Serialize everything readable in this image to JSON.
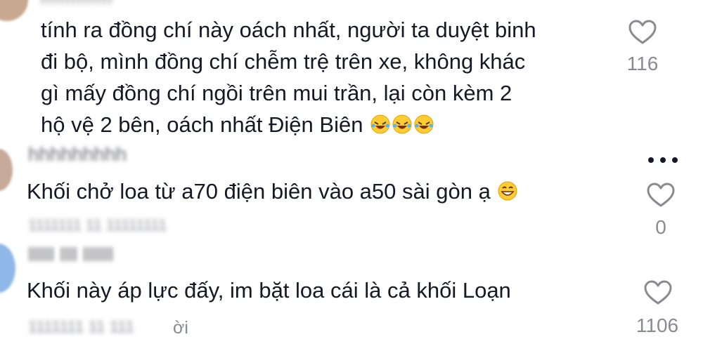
{
  "comments": [
    {
      "lines": [
        "tính ra đồng chí này oách nhất, người ta duyệt binh",
        "đi bộ, mình đồng chí chễm trệ trên xe, không khác",
        "gì mấy đồng chí ngồi trên mui trần, lại còn kèm 2",
        "hộ vệ 2 bên, oách nhất Điện Biên"
      ],
      "emoji": [
        "rofl-emoji",
        "rofl-emoji",
        "rofl-emoji"
      ],
      "likes": "116"
    },
    {
      "text": "Khối chở loa từ a70 điện biên vào a50 sài gòn ạ",
      "emoji": [
        "grinning-emoji"
      ],
      "likes": "0"
    },
    {
      "text": "Khối này áp lực đấy, im bặt loa cái là cả khối Loạn",
      "reply_suffix": "ời",
      "likes": "1106"
    }
  ],
  "icons": {
    "like": "heart-outline-icon",
    "more": "more-dots-icon"
  },
  "colors": {
    "text": "#161823",
    "muted": "#8a8b91"
  }
}
